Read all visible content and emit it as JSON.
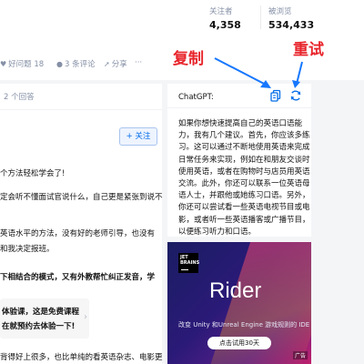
{
  "stats": [
    {
      "label": "关注者",
      "value": "4,358"
    },
    {
      "label": "被浏览",
      "value": "534,433"
    }
  ],
  "actions": {
    "good_question": "好问题 18",
    "comments": "3 条评论",
    "share": "分享",
    "more": "···"
  },
  "annotations": {
    "copy": "复制",
    "retry": "重试"
  },
  "answers": {
    "count_label": "2 个回答",
    "follow_label": "+ 关注",
    "lines": [
      "个方法轻松学会了!",
      "定会听不懂面试官说什么，自己更是紧张到说不",
      "英语水平的方法，没有好的老师引导，也没有",
      "和我决定报班。",
      "下相结合的模式，又有外教帮忙纠正发音，学"
    ],
    "promo_lines": [
      "体验课，这是免费课程",
      "在就预约去体验一下!"
    ],
    "bottom_line": "背得好上很多，也比单纯的看英语杂志、电影更"
  },
  "gpt": {
    "title": "ChatGPT:",
    "body_lines": [
      "如果你想快速提高自己的英语口语能",
      "力，我有几个建议。首先，你应该多练",
      "习。这可以通过不断地使用英语来完成",
      "日常任务来实现，例如在和朋友交谈时",
      "使用英语，或者在购物时与店员用英语",
      "交流。此外，你还可以联系一位英语母",
      "语人士，并跟他或她练习口语。另外，",
      "你还可以尝试看一些英语电视节目或电",
      "影，或者听一些英语播客或广播节目，",
      "以便练习听力和口语。"
    ]
  },
  "ad": {
    "brand_line1": "JET",
    "brand_line2": "BRAINS",
    "product": "Rider",
    "subtitle": "改变 Unity 和Unreal Engine 游戏规则的 IDE",
    "cta": "点击试用30天",
    "tag": "广告"
  },
  "colors": {
    "accent": "#056de8",
    "annotation": "#e8242b",
    "muted": "#8590a6"
  }
}
